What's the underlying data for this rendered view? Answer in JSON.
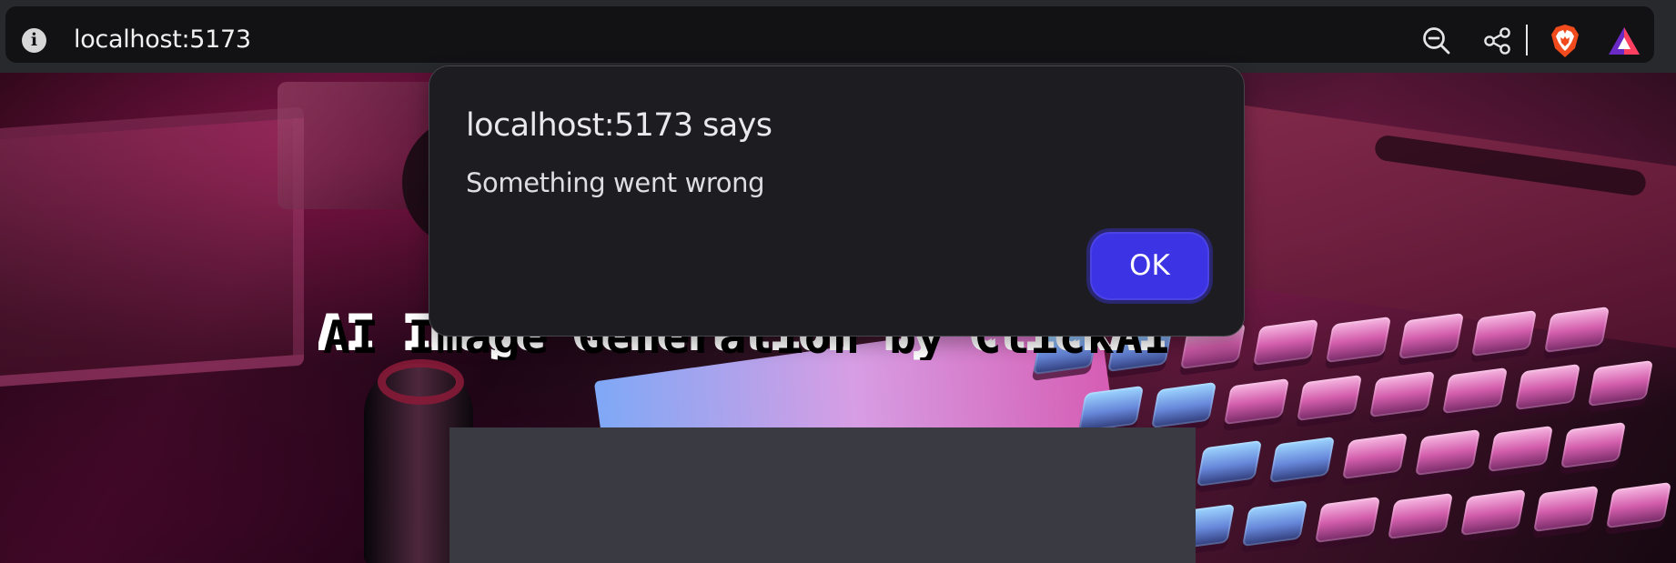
{
  "browser": {
    "url": "localhost:5173",
    "site_info_icon": "info-icon",
    "toolbar_icons": [
      "zoom-out-icon",
      "share-icon",
      "brave-shield-icon",
      "brave-rewards-icon"
    ]
  },
  "page": {
    "title": "AI Image Generation by ClickAI™",
    "background_image": "retro computer keyboard and joystick"
  },
  "alert": {
    "title": "localhost:5173 says",
    "message": "Something went wrong",
    "ok_label": "OK"
  },
  "colors": {
    "dialog_background": "#1d1d21",
    "ok_button": "#3c33e4",
    "content_panel": "#393a42",
    "brave_orange": "#f04a1d"
  }
}
